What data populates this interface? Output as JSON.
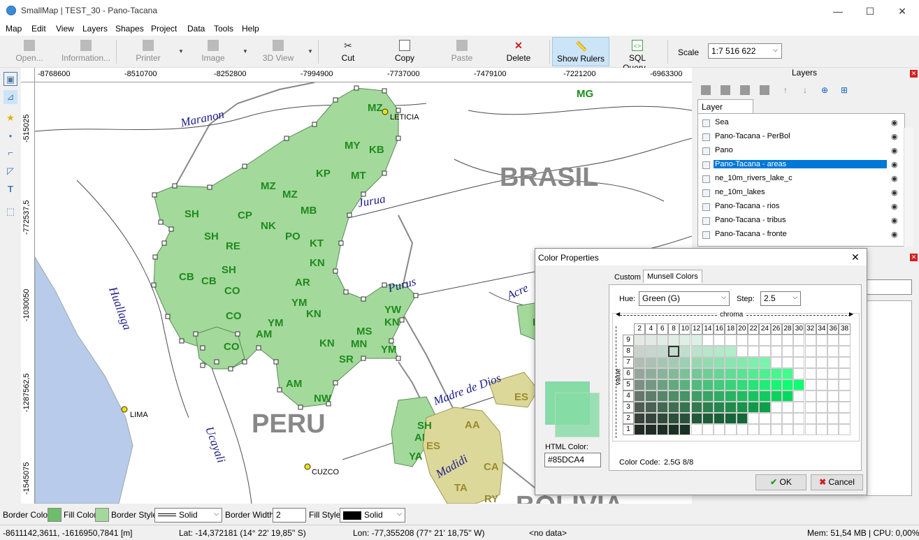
{
  "window": {
    "title": "SmallMap | TEST_30 - Pano-Tacana",
    "controls": [
      "—",
      "☐",
      "✕"
    ]
  },
  "menu": [
    "Map",
    "Edit",
    "View",
    "Layers",
    "Shapes",
    "Project",
    "Data",
    "Tools",
    "Help"
  ],
  "toolbar": {
    "open": "Open...",
    "information": "Information...",
    "printer": "Printer",
    "image": "Image",
    "view3d": "3D View",
    "cut": "Cut",
    "copy": "Copy",
    "paste": "Paste",
    "delete": "Delete",
    "show_rulers": "Show Rulers",
    "sql_query": "SQL Query...",
    "scale_label": "Scale",
    "scale_value": "1:7 516 622"
  },
  "ruler": {
    "x_ticks": [
      "-8768600",
      "-8510700",
      "-8252800",
      "-7994900",
      "-7737000",
      "-7479100",
      "-7221200",
      "-6963300"
    ],
    "y_ticks": [
      "-515025",
      "-772537,5",
      "-1030050",
      "-1287562,5",
      "-1545075"
    ]
  },
  "map": {
    "countries": [
      "BRASIL",
      "PERU",
      "BOLIVIA"
    ],
    "rivers": [
      "Maranon",
      "Jurua",
      "Huallaga",
      "Purus",
      "Acre",
      "Madre de Dios",
      "Ucayali",
      "Madidi"
    ],
    "cities": [
      "LETICIA",
      "LIMA",
      "CUZCO"
    ],
    "green_codes": [
      "MZ",
      "MY",
      "KB",
      "KP",
      "MT",
      "MZ",
      "MZ",
      "SH",
      "CP",
      "MB",
      "NK",
      "PO",
      "SH",
      "RE",
      "KT",
      "KN",
      "SH",
      "CB",
      "CB",
      "CO",
      "AR",
      "YM",
      "KN",
      "CO",
      "YM",
      "AM",
      "CO",
      "YW",
      "KN",
      "MS",
      "KN",
      "MN",
      "YM",
      "SR",
      "AM",
      "NW",
      "MG",
      "KX",
      "SH",
      "AI",
      "YA"
    ],
    "olive_codes": [
      "ES",
      "AA",
      "ES",
      "CA",
      "TA",
      "RY"
    ]
  },
  "layers": {
    "title": "Layers",
    "tab": "Layer Manager",
    "items": [
      "Sea",
      "Pano-Tacana - PerBol",
      "Pano",
      "Pano-Tacana - areas",
      "ne_10m_rivers_lake_c",
      "ne_10m_lakes",
      "Pano-Tacana - rios",
      "Pano-Tacana - tribus",
      "Pano-Tacana - fronte"
    ],
    "selected": "Pano-Tacana - areas"
  },
  "dialog": {
    "title": "Color Properties",
    "tabs": [
      "Custom",
      "Munsell Colors"
    ],
    "hue_label": "Hue:",
    "hue_value": "Green (G)",
    "step_label": "Step:",
    "step_value": "2.5",
    "chroma_label": "chroma",
    "value_label": "value",
    "chroma_ticks": [
      "2",
      "4",
      "6",
      "8",
      "10",
      "12",
      "14",
      "16",
      "18",
      "20",
      "22",
      "24",
      "26",
      "28",
      "30",
      "32",
      "34",
      "36",
      "38"
    ],
    "value_ticks": [
      "9",
      "8",
      "7",
      "6",
      "5",
      "4",
      "3",
      "2",
      "1"
    ],
    "html_color_label": "HTML Color:",
    "html_color": "#85DCA4",
    "color_code_label": "Color Code:",
    "color_code": "2.5G 8/8",
    "ok": "OK",
    "cancel": "Cancel"
  },
  "stylebar": {
    "border_color_label": "Border Color:",
    "fill_color_label": "Fill Color:",
    "border_style_label": "Border Style:",
    "border_style": "Solid",
    "border_width_label": "Border Width:",
    "border_width": "2",
    "fill_style_label": "Fill Style:",
    "fill_style": "Solid"
  },
  "status": {
    "coords": "-8611142,3611,  -1616950,7841 [m]",
    "lat": "Lat: -14,372181 (14° 22' 19,85'' S)",
    "lon": "Lon: -77,355208 (77° 21' 18,75'' W)",
    "data": "<no data>",
    "mem": "Mem: 51,54 MB | CPU: 0,00%"
  },
  "colors": {
    "fill_green": "#85DCA4",
    "area_green": "#a3d99a",
    "olive": "#dcd89a",
    "sea": "#b9cbea",
    "select": "#0078d7"
  }
}
